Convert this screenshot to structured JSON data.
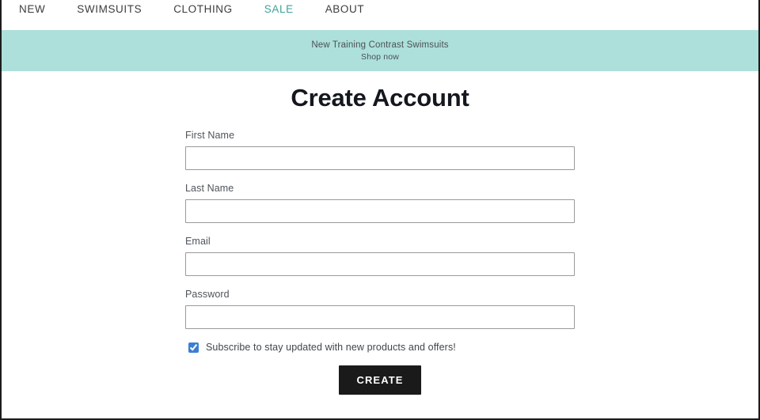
{
  "nav": {
    "items": [
      {
        "label": "NEW",
        "active": false
      },
      {
        "label": "SWIMSUITS",
        "active": false
      },
      {
        "label": "CLOTHING",
        "active": false
      },
      {
        "label": "SALE",
        "active": true
      },
      {
        "label": "ABOUT",
        "active": false
      }
    ],
    "accent_color": "#3fa399"
  },
  "promo_banner": {
    "headline": "New Training Contrast Swimsuits",
    "cta": "Shop now",
    "background_color": "#ade0da",
    "text_color": "#4a5157"
  },
  "main": {
    "title": "Create Account",
    "title_color": "#14171e",
    "form": {
      "fields": [
        {
          "label": "First Name",
          "value": "",
          "placeholder": "",
          "type": "text"
        },
        {
          "label": "Last Name",
          "value": "",
          "placeholder": "",
          "type": "text"
        },
        {
          "label": "Email",
          "value": "",
          "placeholder": "",
          "type": "email"
        },
        {
          "label": "Password",
          "value": "",
          "placeholder": "",
          "type": "password"
        }
      ],
      "subscribe": {
        "label": "Subscribe to stay updated with new products and offers!",
        "checked": true,
        "checkbox_color": "#3b7fd4"
      },
      "submit": {
        "label": "CREATE",
        "background_color": "#1a1a1a",
        "text_color": "#ffffff"
      }
    }
  }
}
